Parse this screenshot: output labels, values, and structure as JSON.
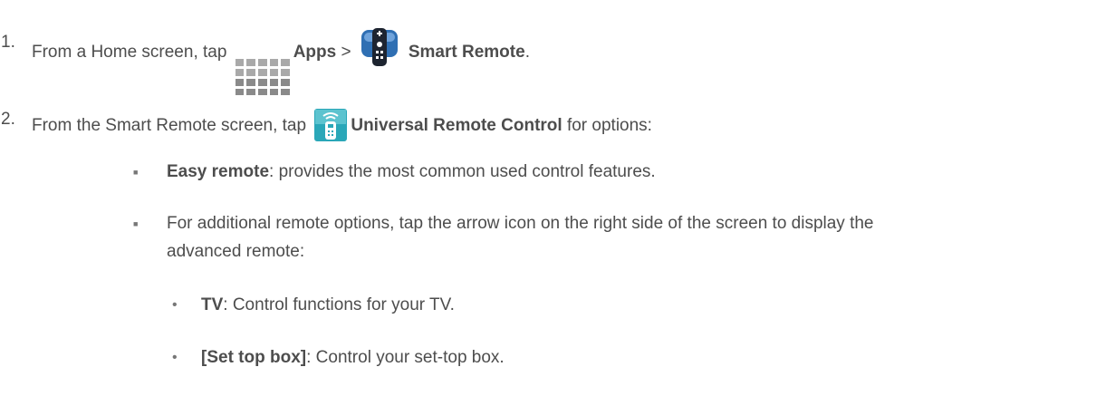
{
  "steps": [
    {
      "number": "1.",
      "prefix": "From a Home screen, tap ",
      "apps_label": "Apps",
      "separator": " > ",
      "remote_label": "Smart Remote",
      "suffix": ".",
      "icons": [
        "apps-grid-icon",
        "smart-remote-app-icon"
      ]
    },
    {
      "number": "2.",
      "prefix": "From the Smart Remote screen, tap ",
      "control_label": "Universal Remote Control",
      "suffix": " for options:",
      "icons": [
        "universal-remote-icon"
      ]
    }
  ],
  "bullets": [
    {
      "bold": "Easy remote",
      "text": ": provides the most common used control features."
    },
    {
      "line1": "For additional remote options, tap the arrow icon on the right side of the screen to display the",
      "line2": "advanced remote:"
    }
  ],
  "sub_bullets": [
    {
      "bold": "TV",
      "text": ": Control functions for your TV."
    },
    {
      "bold": "[Set top box]",
      "text": ": Control your set-top box."
    }
  ],
  "colors": {
    "text": "#4d4d4d",
    "icon_blue": "#2f6fb3",
    "icon_teal": "#2aa7b8"
  }
}
